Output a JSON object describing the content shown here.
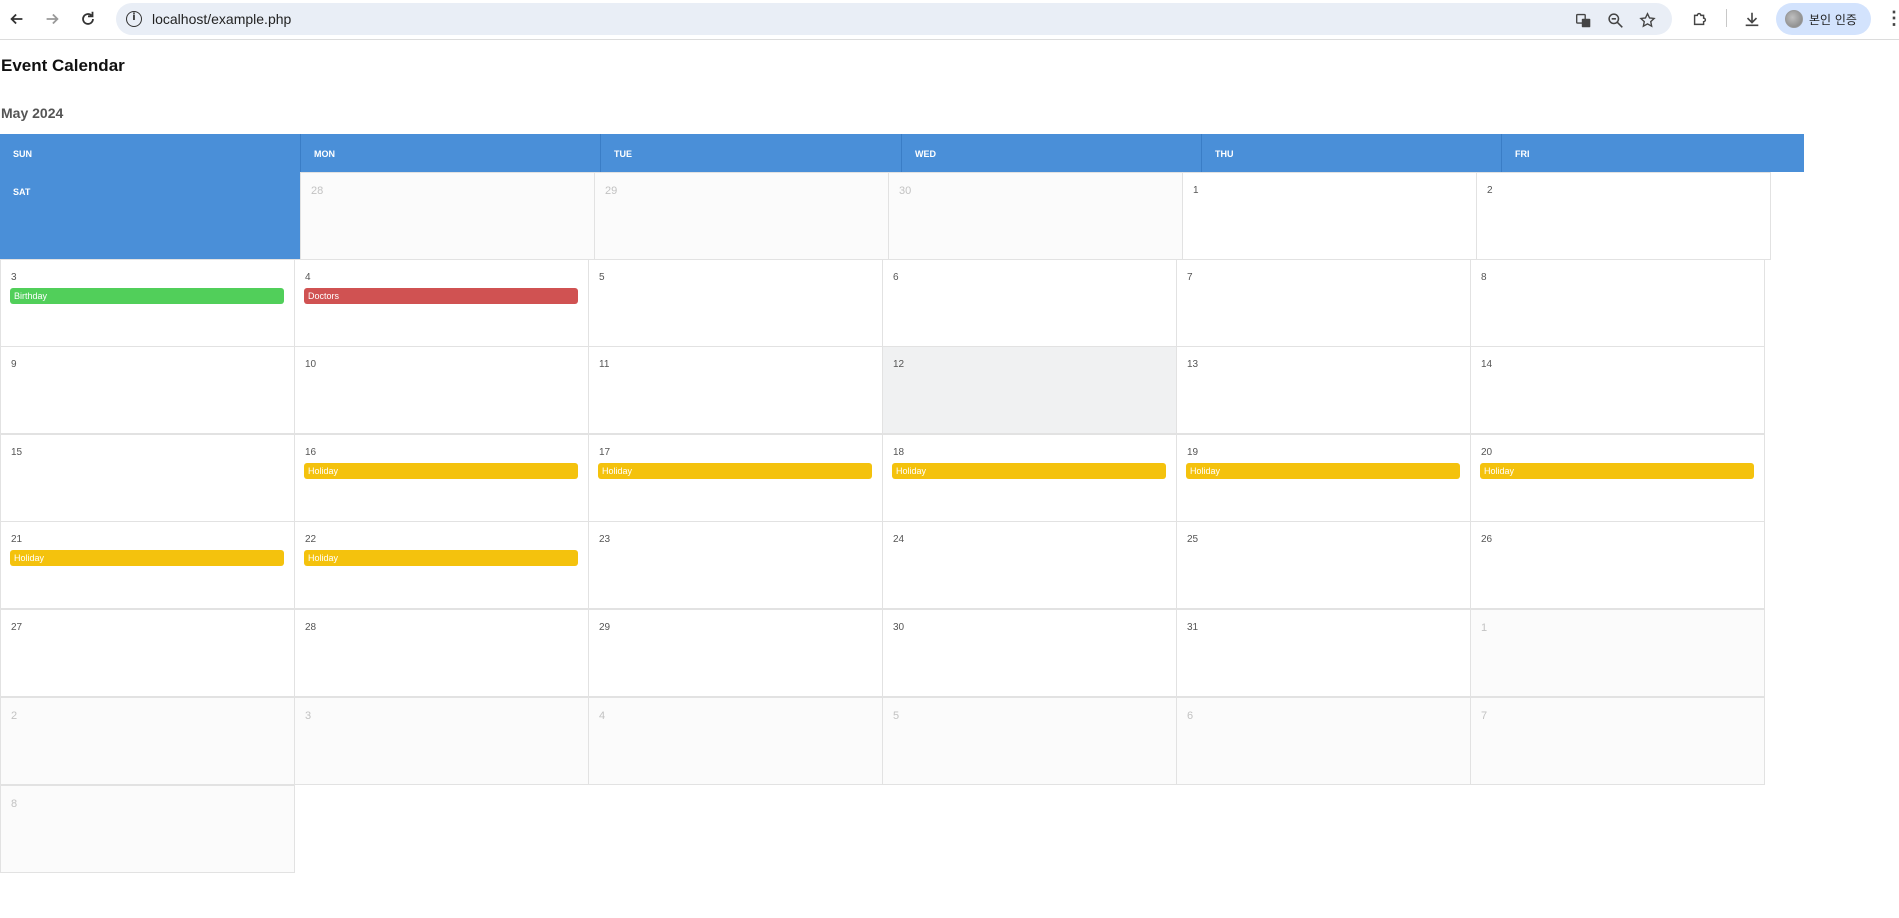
{
  "browser": {
    "url": "localhost/example.php",
    "profile_label": "본인 인증",
    "icons": [
      "back-icon",
      "forward-icon",
      "reload-icon",
      "info-icon",
      "translate-icon",
      "zoom-icon",
      "star-icon",
      "extensions-icon",
      "download-icon",
      "menu-icon"
    ]
  },
  "page": {
    "title": "Event Calendar",
    "month": "May 2024"
  },
  "weekdays": [
    "SUN",
    "MON",
    "TUE",
    "WED",
    "THU",
    "FRI"
  ],
  "saturday_label": "SAT",
  "colors": {
    "header_blue": "#4a8fd8",
    "birthday": "#51cf5a",
    "doctors": "#d05252",
    "holiday": "#f4c20d",
    "today_bg": "#f0f1f2"
  },
  "rows": [
    {
      "cells": [
        {
          "day": "28",
          "muted": true
        },
        {
          "day": "29",
          "muted": true
        },
        {
          "day": "30",
          "muted": true
        },
        {
          "day": "1"
        },
        {
          "day": "2"
        }
      ]
    },
    {
      "cells": [
        {
          "day": "3",
          "event": "Birthday",
          "event_color": "birthday"
        },
        {
          "day": "4",
          "event": "Doctors",
          "event_color": "doctors"
        },
        {
          "day": "5"
        },
        {
          "day": "6"
        },
        {
          "day": "7"
        },
        {
          "day": "8"
        }
      ]
    },
    {
      "cells": [
        {
          "day": "9"
        },
        {
          "day": "10"
        },
        {
          "day": "11"
        },
        {
          "day": "12",
          "today": true
        },
        {
          "day": "13"
        },
        {
          "day": "14"
        }
      ]
    },
    {
      "cells": [
        {
          "day": "15"
        },
        {
          "day": "16",
          "event": "Holiday",
          "event_color": "holiday"
        },
        {
          "day": "17",
          "event": "Holiday",
          "event_color": "holiday"
        },
        {
          "day": "18",
          "event": "Holiday",
          "event_color": "holiday"
        },
        {
          "day": "19",
          "event": "Holiday",
          "event_color": "holiday"
        },
        {
          "day": "20",
          "event": "Holiday",
          "event_color": "holiday"
        }
      ]
    },
    {
      "cells": [
        {
          "day": "21",
          "event": "Holiday",
          "event_color": "holiday"
        },
        {
          "day": "22",
          "event": "Holiday",
          "event_color": "holiday"
        },
        {
          "day": "23"
        },
        {
          "day": "24"
        },
        {
          "day": "25"
        },
        {
          "day": "26"
        }
      ]
    },
    {
      "cells": [
        {
          "day": "27"
        },
        {
          "day": "28"
        },
        {
          "day": "29"
        },
        {
          "day": "30"
        },
        {
          "day": "31"
        },
        {
          "day": "1",
          "muted": true
        }
      ]
    },
    {
      "cells": [
        {
          "day": "2",
          "muted": true
        },
        {
          "day": "3",
          "muted": true
        },
        {
          "day": "4",
          "muted": true
        },
        {
          "day": "5",
          "muted": true
        },
        {
          "day": "6",
          "muted": true
        },
        {
          "day": "7",
          "muted": true
        }
      ]
    },
    {
      "cells": [
        {
          "day": "8",
          "muted": true
        }
      ]
    }
  ]
}
